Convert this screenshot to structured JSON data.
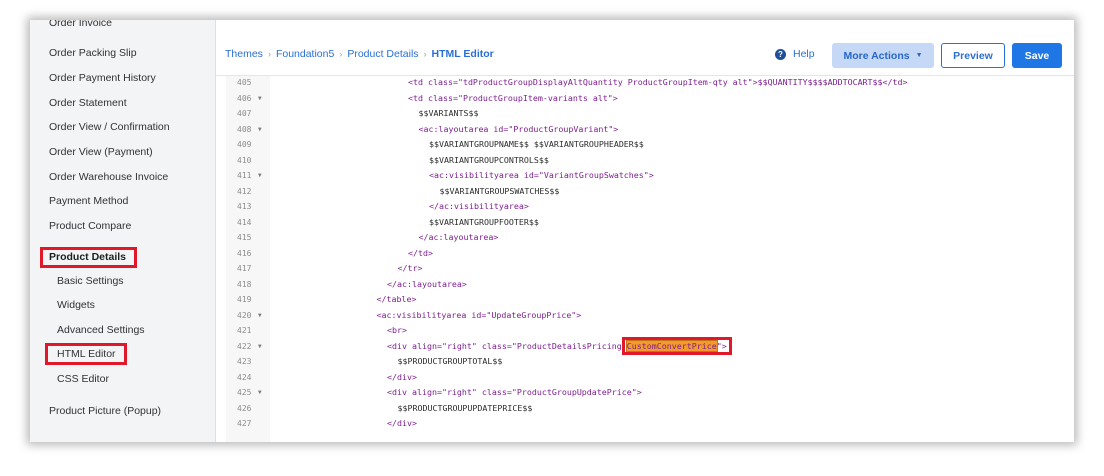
{
  "sidebar": {
    "items": [
      {
        "label": "Order Invoice",
        "kind": "normal"
      },
      {
        "label": "Order Packing Slip",
        "kind": "normal"
      },
      {
        "label": "Order Payment History",
        "kind": "normal"
      },
      {
        "label": "Order Statement",
        "kind": "normal"
      },
      {
        "label": "Order View / Confirmation",
        "kind": "normal"
      },
      {
        "label": "Order View (Payment)",
        "kind": "normal"
      },
      {
        "label": "Order Warehouse Invoice",
        "kind": "normal"
      },
      {
        "label": "Payment Method",
        "kind": "normal"
      },
      {
        "label": "Product Compare",
        "kind": "normal"
      },
      {
        "label": "Product Details",
        "kind": "bold"
      },
      {
        "label": "Basic Settings",
        "kind": "sub"
      },
      {
        "label": "Widgets",
        "kind": "sub"
      },
      {
        "label": "Advanced Settings",
        "kind": "sub"
      },
      {
        "label": "HTML Editor",
        "kind": "sub"
      },
      {
        "label": "CSS Editor",
        "kind": "sub"
      },
      {
        "label": "Product Picture (Popup)",
        "kind": "normal"
      }
    ]
  },
  "breadcrumb": [
    "Themes",
    "Foundation5",
    "Product Details",
    "HTML Editor"
  ],
  "header": {
    "help_label": "Help",
    "help_icon": "?",
    "more_actions_label": "More Actions",
    "preview_label": "Preview",
    "save_label": "Save"
  },
  "colors": {
    "link": "#2a6fd6",
    "save_bg": "#1f77e6",
    "more_actions_bg": "#c5d8f6",
    "highlight_red": "#e0182a",
    "match_orange": "#f39a2b"
  },
  "editor": {
    "highlighted_text": "CustomConvertPrice",
    "lines": [
      {
        "num": "405",
        "fold": false,
        "indent": 12,
        "segments": [
          {
            "t": "<td class=\"tdProductGroupDisplayAltQuantity ProductGroupItem-qty alt\">$$QUANTITY$$$$ADDTOCART$$</td>",
            "c": "tag"
          }
        ]
      },
      {
        "num": "406",
        "fold": true,
        "indent": 12,
        "segments": [
          {
            "t": "<td class=\"ProductGroupItem-variants alt\">",
            "c": "tag"
          }
        ]
      },
      {
        "num": "407",
        "fold": false,
        "indent": 13,
        "segments": [
          {
            "t": "$$VARIANTS$$",
            "c": "plain"
          }
        ]
      },
      {
        "num": "408",
        "fold": true,
        "indent": 13,
        "segments": [
          {
            "t": "<ac:layoutarea id=\"ProductGroupVariant\">",
            "c": "tag"
          }
        ]
      },
      {
        "num": "409",
        "fold": false,
        "indent": 14,
        "segments": [
          {
            "t": "$$VARIANTGROUPNAME$$ $$VARIANTGROUPHEADER$$",
            "c": "plain"
          }
        ]
      },
      {
        "num": "410",
        "fold": false,
        "indent": 14,
        "segments": [
          {
            "t": "$$VARIANTGROUPCONTROLS$$",
            "c": "plain"
          }
        ]
      },
      {
        "num": "411",
        "fold": true,
        "indent": 14,
        "segments": [
          {
            "t": "<ac:visibilityarea id=\"VariantGroupSwatches\">",
            "c": "tag"
          }
        ]
      },
      {
        "num": "412",
        "fold": false,
        "indent": 15,
        "segments": [
          {
            "t": "$$VARIANTGROUPSWATCHES$$",
            "c": "plain"
          }
        ]
      },
      {
        "num": "413",
        "fold": false,
        "indent": 14,
        "segments": [
          {
            "t": "</ac:visibilityarea>",
            "c": "tag"
          }
        ]
      },
      {
        "num": "414",
        "fold": false,
        "indent": 14,
        "segments": [
          {
            "t": "$$VARIANTGROUPFOOTER$$",
            "c": "plain"
          }
        ]
      },
      {
        "num": "415",
        "fold": false,
        "indent": 13,
        "segments": [
          {
            "t": "</ac:layoutarea>",
            "c": "tag"
          }
        ]
      },
      {
        "num": "416",
        "fold": false,
        "indent": 12,
        "segments": [
          {
            "t": "</td>",
            "c": "tag"
          }
        ]
      },
      {
        "num": "417",
        "fold": false,
        "indent": 11,
        "segments": [
          {
            "t": "</tr>",
            "c": "tag"
          }
        ]
      },
      {
        "num": "418",
        "fold": false,
        "indent": 10,
        "segments": [
          {
            "t": "</ac:layoutarea>",
            "c": "tag"
          }
        ]
      },
      {
        "num": "419",
        "fold": false,
        "indent": 9,
        "segments": [
          {
            "t": "</table>",
            "c": "tag"
          }
        ]
      },
      {
        "num": "420",
        "fold": true,
        "indent": 9,
        "segments": [
          {
            "t": "<ac:visibilityarea id=\"UpdateGroupPrice\">",
            "c": "tag"
          }
        ]
      },
      {
        "num": "421",
        "fold": false,
        "indent": 10,
        "segments": [
          {
            "t": "<br>",
            "c": "tag"
          }
        ]
      },
      {
        "num": "422",
        "fold": true,
        "indent": 10,
        "segments": [
          {
            "t": "<div align=\"right\" class=\"ProductDetailsPricing ",
            "c": "tag"
          },
          {
            "t": "CustomConvertPrice",
            "c": "hl"
          },
          {
            "t": "\">",
            "c": "tag"
          }
        ]
      },
      {
        "num": "423",
        "fold": false,
        "indent": 11,
        "segments": [
          {
            "t": "$$PRODUCTGROUPTOTAL$$",
            "c": "plain"
          }
        ]
      },
      {
        "num": "424",
        "fold": false,
        "indent": 10,
        "segments": [
          {
            "t": "</div>",
            "c": "tag"
          }
        ]
      },
      {
        "num": "425",
        "fold": true,
        "indent": 10,
        "segments": [
          {
            "t": "<div align=\"right\" class=\"ProductGroupUpdatePrice\">",
            "c": "tag"
          }
        ]
      },
      {
        "num": "426",
        "fold": false,
        "indent": 11,
        "segments": [
          {
            "t": "$$PRODUCTGROUPUPDATEPRICE$$",
            "c": "plain"
          }
        ]
      },
      {
        "num": "427",
        "fold": false,
        "indent": 10,
        "segments": [
          {
            "t": "</div>",
            "c": "tag"
          }
        ]
      }
    ]
  }
}
